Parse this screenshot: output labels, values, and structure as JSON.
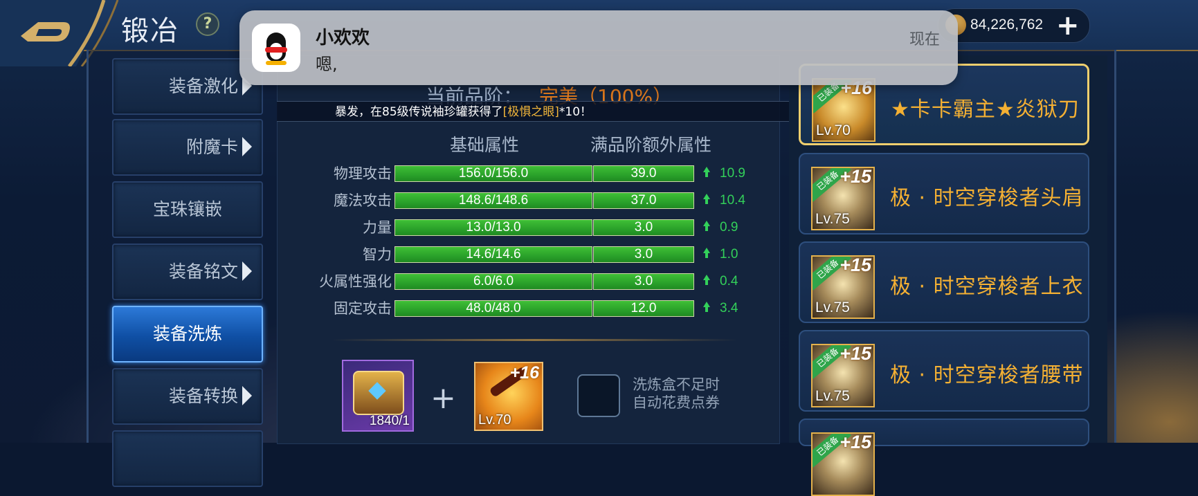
{
  "header": {
    "title": "锻冶",
    "help_glyph": "?",
    "gold_amount": "84,226,762",
    "add_glyph": "+"
  },
  "sidebar": {
    "items": [
      {
        "label": "装备激化",
        "arrow": true
      },
      {
        "label": "附魔卡",
        "arrow": true
      },
      {
        "label": "宝珠镶嵌",
        "arrow": false
      },
      {
        "label": "装备铭文",
        "arrow": true
      },
      {
        "label": "装备洗炼",
        "arrow": false,
        "active": true
      },
      {
        "label": "装备转换",
        "arrow": true
      }
    ]
  },
  "quality": {
    "label": "当前品阶：",
    "value": "完美（100%）"
  },
  "ticker": {
    "prefix": "暴发，在85级传说袖珍罐获得了",
    "item": "[极惧之眼]",
    "suffix": "*10！"
  },
  "stats": {
    "base_header": "基础属性",
    "extra_header": "满品阶额外属性",
    "rows": [
      {
        "name": "物理攻击",
        "base": "156.0/156.0",
        "extra": "39.0",
        "inc": "10.9"
      },
      {
        "name": "魔法攻击",
        "base": "148.6/148.6",
        "extra": "37.0",
        "inc": "10.4"
      },
      {
        "name": "力量",
        "base": "13.0/13.0",
        "extra": "3.0",
        "inc": "0.9"
      },
      {
        "name": "智力",
        "base": "14.6/14.6",
        "extra": "3.0",
        "inc": "1.0"
      },
      {
        "name": "火属性强化",
        "base": "6.0/6.0",
        "extra": "3.0",
        "inc": "0.4"
      },
      {
        "name": "固定攻击",
        "base": "48.0/48.0",
        "extra": "12.0",
        "inc": "3.4"
      }
    ]
  },
  "refine": {
    "material_count": "1840/1",
    "plus_glyph": "+",
    "target_enhance": "+16",
    "target_level": "Lv.70",
    "auto_note_line1": "洗炼盒不足时",
    "auto_note_line2": "自动花费点券"
  },
  "equipment": [
    {
      "name": "★卡卡霸主★炎狱刀",
      "enhance": "+16",
      "level": "Lv.70",
      "equipped_tag": "已装备",
      "selected": true
    },
    {
      "name": "极 · 时空穿梭者头肩",
      "enhance": "+15",
      "level": "Lv.75",
      "equipped_tag": "已装备"
    },
    {
      "name": "极 · 时空穿梭者上衣",
      "enhance": "+15",
      "level": "Lv.75",
      "equipped_tag": "已装备"
    },
    {
      "name": "极 · 时空穿梭者腰带",
      "enhance": "+15",
      "level": "Lv.75",
      "equipped_tag": "已装备"
    },
    {
      "name": "",
      "enhance": "+15",
      "level": "",
      "equipped_tag": "已装备"
    }
  ],
  "notification": {
    "app_icon": "qq-penguin-icon",
    "sender": "小欢欢",
    "message": "嗯,",
    "time": "现在"
  },
  "colors": {
    "accent_gold": "#f4b033",
    "bar_green": "#2aa12a",
    "increase_green": "#33d05a",
    "active_blue": "#1e62c4",
    "quality_orange": "#e07a1d"
  }
}
